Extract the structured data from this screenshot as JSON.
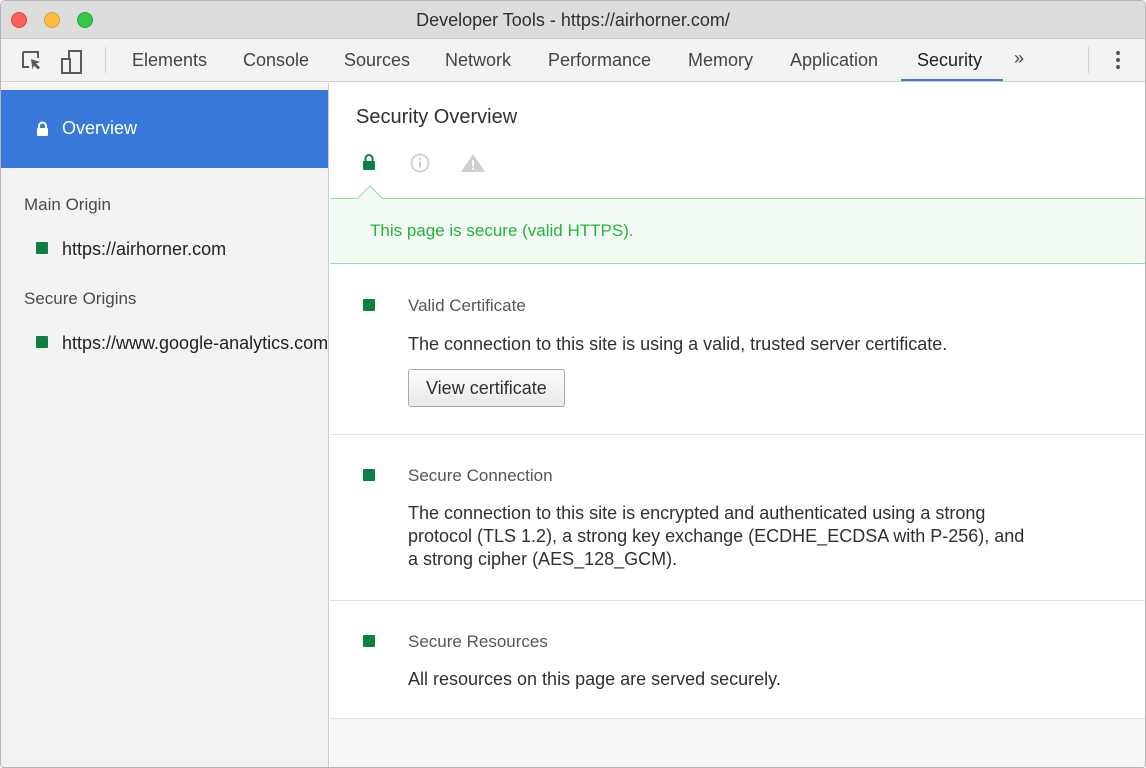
{
  "window": {
    "title": "Developer Tools - https://airhorner.com/"
  },
  "toolbar": {
    "tabs": [
      {
        "label": "Elements"
      },
      {
        "label": "Console"
      },
      {
        "label": "Sources"
      },
      {
        "label": "Network"
      },
      {
        "label": "Performance"
      },
      {
        "label": "Memory"
      },
      {
        "label": "Application"
      },
      {
        "label": "Security",
        "active": true
      }
    ],
    "more_tabs_label": "»",
    "icons": [
      "inspect-element-icon",
      "device-toolbar-icon",
      "overflow-menu-icon"
    ]
  },
  "sidebar": {
    "overview_label": "Overview",
    "main_origin_heading": "Main Origin",
    "main_origin": "https://airhorner.com",
    "secure_origins_heading": "Secure Origins",
    "secure_origins": [
      "https://www.google-analytics.com"
    ]
  },
  "main": {
    "title": "Security Overview",
    "summary_icons": [
      "secure-lock-icon",
      "info-icon",
      "warning-icon"
    ],
    "summary_text": "This page is secure (valid HTTPS).",
    "sections": [
      {
        "title": "Valid Certificate",
        "description": "The connection to this site is using a valid, trusted server certificate.",
        "button_label": "View certificate"
      },
      {
        "title": "Secure Connection",
        "description": "The connection to this site is encrypted and authenticated using a strong protocol (TLS 1.2), a strong key exchange (ECDHE_ECDSA with P-256), and a strong cipher (AES_128_GCM)."
      },
      {
        "title": "Secure Resources",
        "description": "All resources on this page are served securely."
      }
    ]
  },
  "colors": {
    "accent": "#3879d9",
    "secure_green": "#0b8043",
    "banner_text": "#26b23e"
  }
}
